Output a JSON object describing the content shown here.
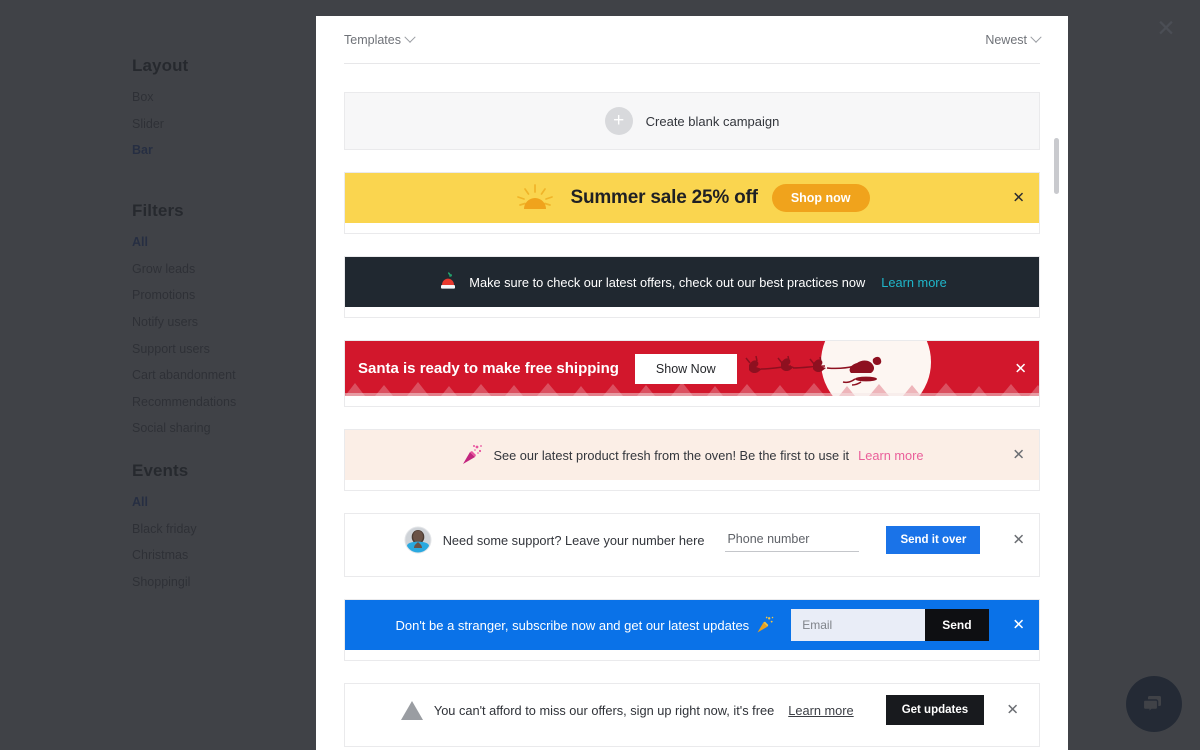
{
  "sidebar": {
    "groups": [
      {
        "title": "Layout",
        "items": [
          {
            "label": "Box",
            "active": false
          },
          {
            "label": "Slider",
            "active": false
          },
          {
            "label": "Bar",
            "active": true
          }
        ]
      },
      {
        "title": "Filters",
        "items": [
          {
            "label": "All",
            "active": true
          },
          {
            "label": "Grow leads",
            "active": false
          },
          {
            "label": "Promotions",
            "active": false
          },
          {
            "label": "Notify users",
            "active": false
          },
          {
            "label": "Support users",
            "active": false
          },
          {
            "label": "Cart abandonment",
            "active": false
          },
          {
            "label": "Recommendations",
            "active": false
          },
          {
            "label": "Social sharing",
            "active": false
          }
        ]
      },
      {
        "title": "Events",
        "items": [
          {
            "label": "All",
            "active": true
          },
          {
            "label": "Black friday",
            "active": false
          },
          {
            "label": "Christmas",
            "active": false
          },
          {
            "label": "Shoppingil",
            "active": false
          }
        ]
      }
    ]
  },
  "overlay": {
    "close_label": "✕"
  },
  "chat_widget": {
    "icon": "chat-bubble-icon",
    "color": "#1c3f6e"
  },
  "modal": {
    "header": {
      "left_dropdown": "Templates",
      "right_dropdown": "Newest"
    },
    "blank_campaign": {
      "plus": "+",
      "label": "Create blank campaign"
    },
    "templates": [
      {
        "id": "summer-sale",
        "style": "yellow",
        "bg": "#fad54f",
        "icon": "sun-icon",
        "text": "Summer sale 25% off",
        "button": "Shop now",
        "close": "✕"
      },
      {
        "id": "best-practices",
        "style": "dark",
        "bg": "#202830",
        "icon": "santa-hat-emoji",
        "text": "Make sure to check our latest offers, check out our best practices now",
        "link": "Learn more",
        "link_color": "#1fb6c9"
      },
      {
        "id": "santa-free-shipping",
        "style": "red",
        "bg": "#d2172c",
        "icon": "santa-sleigh-icon",
        "text": "Santa is ready to make free shipping",
        "button": "Show Now",
        "close": "✕"
      },
      {
        "id": "fresh-from-oven",
        "style": "peach",
        "bg": "#fbeee6",
        "icon": "party-popper-emoji",
        "text": "See our latest product fresh from the oven! Be the first to use it",
        "link": "Learn more",
        "link_color": "#ea5f9a",
        "close": "✕"
      },
      {
        "id": "support-phone",
        "style": "white",
        "bg": "#ffffff",
        "icon": "avatar-icon",
        "text": "Need some support? Leave your number here",
        "input_placeholder": "Phone number",
        "input_value": "",
        "button": "Send it over",
        "close": "✕"
      },
      {
        "id": "subscribe-updates",
        "style": "blue",
        "bg": "#0a72e8",
        "icon": "party-popper-emoji",
        "text": "Don't be a stranger, subscribe now and get our latest updates",
        "input_placeholder": "Email",
        "input_value": "",
        "button": "Send",
        "close": "✕"
      },
      {
        "id": "cant-afford-to-miss",
        "style": "plain",
        "bg": "#ffffff",
        "icon": "triangle-icon",
        "text": "You can't afford to miss our offers, sign up right now, it's free",
        "link": "Learn more",
        "button": "Get updates",
        "close": "✕"
      }
    ]
  }
}
